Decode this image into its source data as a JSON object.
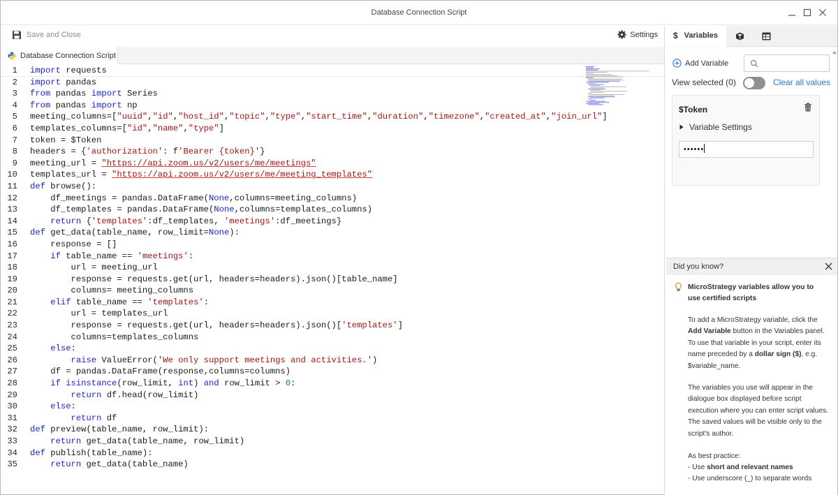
{
  "window": {
    "title": "Database Connection Script"
  },
  "toolbar": {
    "save_label": "Save and Close",
    "settings_label": "Settings"
  },
  "editor": {
    "tab_label": "Database Connection Script",
    "lines": [
      {
        "n": "1",
        "code": "import requests"
      },
      {
        "n": "2",
        "code": "import pandas"
      },
      {
        "n": "3",
        "code": "from pandas import Series"
      },
      {
        "n": "4",
        "code": "from pandas import np"
      },
      {
        "n": "5",
        "code": "meeting_columns=[\"uuid\",\"id\",\"host_id\",\"topic\",\"type\",\"start_time\",\"duration\",\"timezone\",\"created_at\",\"join_url\"]"
      },
      {
        "n": "6",
        "code": "templates_columns=[\"id\",\"name\",\"type\"]"
      },
      {
        "n": "7",
        "code": "token = $Token"
      },
      {
        "n": "8",
        "code": "headers = {'authorization': f'Bearer {token}'}"
      },
      {
        "n": "9",
        "code": "meeting_url = \"https://api.zoom.us/v2/users/me/meetings\""
      },
      {
        "n": "10",
        "code": "templates_url = \"https://api.zoom.us/v2/users/me/meeting_templates\""
      },
      {
        "n": "11",
        "code": "def browse():"
      },
      {
        "n": "12",
        "code": "    df_meetings = pandas.DataFrame(None,columns=meeting_columns)"
      },
      {
        "n": "13",
        "code": "    df_templates = pandas.DataFrame(None,columns=templates_columns)"
      },
      {
        "n": "14",
        "code": "    return {'templates':df_templates, 'meetings':df_meetings}"
      },
      {
        "n": "15",
        "code": "def get_data(table_name, row_limit=None):"
      },
      {
        "n": "16",
        "code": "    response = []"
      },
      {
        "n": "17",
        "code": "    if table_name == 'meetings':"
      },
      {
        "n": "18",
        "code": "        url = meeting_url"
      },
      {
        "n": "19",
        "code": "        response = requests.get(url, headers=headers).json()[table_name]"
      },
      {
        "n": "20",
        "code": "        columns= meeting_columns"
      },
      {
        "n": "21",
        "code": "    elif table_name == 'templates':"
      },
      {
        "n": "22",
        "code": "        url = templates_url"
      },
      {
        "n": "23",
        "code": "        response = requests.get(url, headers=headers).json()['templates']"
      },
      {
        "n": "24",
        "code": "        columns=templates_columns"
      },
      {
        "n": "25",
        "code": "    else:"
      },
      {
        "n": "26",
        "code": "        raise ValueError('We only support meetings and activities.')"
      },
      {
        "n": "27",
        "code": "    df = pandas.DataFrame(response,columns=columns)"
      },
      {
        "n": "28",
        "code": "    if isinstance(row_limit, int) and row_limit > 0:"
      },
      {
        "n": "29",
        "code": "        return df.head(row_limit)"
      },
      {
        "n": "30",
        "code": "    else:"
      },
      {
        "n": "31",
        "code": "        return df"
      },
      {
        "n": "32",
        "code": "def preview(table_name, row_limit):"
      },
      {
        "n": "33",
        "code": "    return get_data(table_name, row_limit)"
      },
      {
        "n": "34",
        "code": "def publish(table_name):"
      },
      {
        "n": "35",
        "code": "    return get_data(table_name)"
      }
    ]
  },
  "panel": {
    "tabs": [
      {
        "label": "Variables",
        "icon": "dollar-icon",
        "active": true
      },
      {
        "label": "",
        "icon": "cube-icon",
        "active": false
      },
      {
        "label": "",
        "icon": "table-icon",
        "active": false
      }
    ],
    "add_variable_label": "Add Variable",
    "search_placeholder": "",
    "view_selected_label": "View selected (0)",
    "clear_all_label": "Clear all values",
    "variable": {
      "name": "$Token",
      "settings_label": "Variable Settings",
      "masked_value": "••••••"
    }
  },
  "tips": {
    "heading": "Did you know?",
    "title": "MicroStrategy variables allow you to use certified scripts",
    "p1": [
      "To add a MicroStrategy variable, click the ",
      "Add Variable",
      " button in the Variables panel. To use that variable in your script, enter its name preceded by a ",
      "dollar sign ($)",
      ", e.g. $variable_name."
    ],
    "p2": "The variables you use will appear in the dialogue box displayed before script execution where you can enter script values. The saved values will be visible only to the script's author.",
    "p3_intro": "As best practice:",
    "p3_item1": [
      "- Use ",
      "short and relevant names"
    ],
    "p3_item2": "- Use underscore (_) to separate words"
  },
  "colors": {
    "keyword": "#1d24c9",
    "string": "#a31515",
    "link": "#2a76d2"
  }
}
